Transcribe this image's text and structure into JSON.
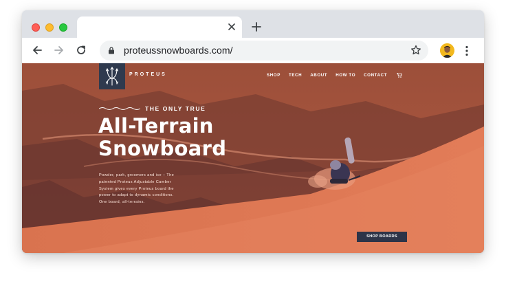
{
  "browser": {
    "url": "proteussnowboards.com/",
    "tab_title": ""
  },
  "site": {
    "brand": "PROTEUS",
    "nav": [
      "SHOP",
      "TECH",
      "ABOUT",
      "HOW TO",
      "CONTACT"
    ],
    "tagline": "THE ONLY TRUE",
    "headline_line1": "All-Terrain",
    "headline_line2": "Snowboard",
    "blurb": "Powder, park, groomers and ice – The patented Proteus Adjustable Camber System gives every Proteus board the power to adapt to dynamic conditions. One board, all-terrains.",
    "cta": "SHOP BOARDS"
  },
  "colors": {
    "hero_overlay": "#b85a3f",
    "logo_box": "#2f3a4e",
    "cta_bg": "#2d3448"
  },
  "icons": [
    "close-icon",
    "plus-icon",
    "back-arrow-icon",
    "forward-arrow-icon",
    "reload-icon",
    "lock-icon",
    "star-icon",
    "avatar",
    "more-vert-icon",
    "cart-icon",
    "trident-logo-icon"
  ]
}
